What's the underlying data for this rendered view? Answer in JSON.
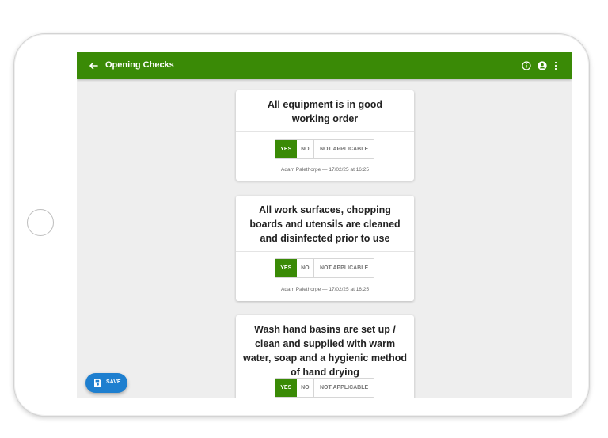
{
  "appbar": {
    "title": "Opening Checks",
    "color": "#3a8a06",
    "icons": [
      "back-arrow-icon",
      "info-icon",
      "account-icon",
      "more-vert-icon"
    ]
  },
  "checks": [
    {
      "question": "All equipment is in good working order",
      "options": [
        "YES",
        "NO",
        "NOT APPLICABLE"
      ],
      "selected": "YES",
      "meta": "Adam Palethorpe — 17/02/25 at 16:25"
    },
    {
      "question": "All work surfaces, chopping boards and utensils are cleaned and disinfected prior to use",
      "options": [
        "YES",
        "NO",
        "NOT APPLICABLE"
      ],
      "selected": "YES",
      "meta": "Adam Palethorpe — 17/02/25 at 16:25"
    },
    {
      "question": "Wash hand basins are set up / clean and supplied with warm water, soap and a hygienic method of hand drying",
      "options": [
        "YES",
        "NO",
        "NOT APPLICABLE"
      ],
      "selected": "YES",
      "meta": ""
    }
  ],
  "save_button": {
    "label": "SAVE",
    "icon": "save-icon",
    "color": "#1e7fcf"
  }
}
